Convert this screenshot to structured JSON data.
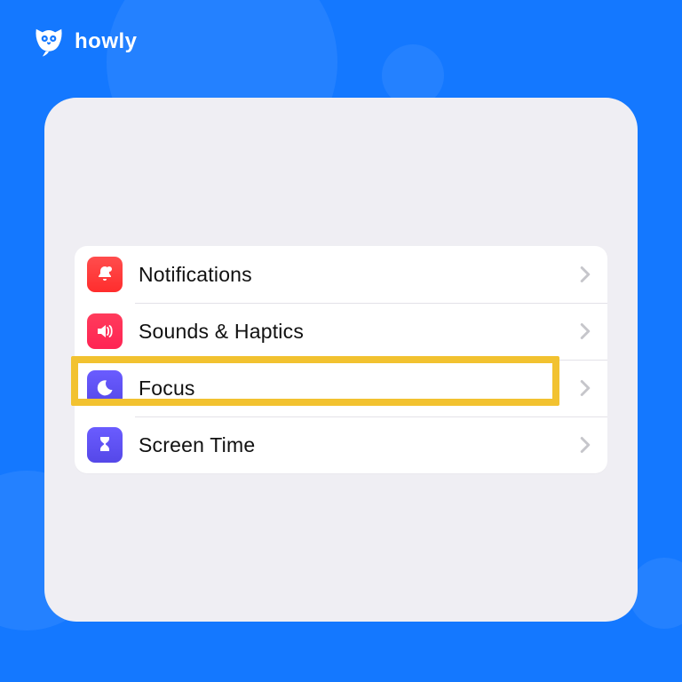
{
  "brand": {
    "name": "howly"
  },
  "settings": {
    "items": [
      {
        "id": "notifications",
        "label": "Notifications",
        "icon": "bell-icon",
        "icon_color": "ic-red"
      },
      {
        "id": "sounds-haptics",
        "label": "Sounds & Haptics",
        "icon": "speaker-icon",
        "icon_color": "ic-pink"
      },
      {
        "id": "focus",
        "label": "Focus",
        "icon": "moon-icon",
        "icon_color": "ic-indigo"
      },
      {
        "id": "screen-time",
        "label": "Screen Time",
        "icon": "hourglass-icon",
        "icon_color": "ic-purple"
      }
    ],
    "highlighted_id": "focus"
  }
}
